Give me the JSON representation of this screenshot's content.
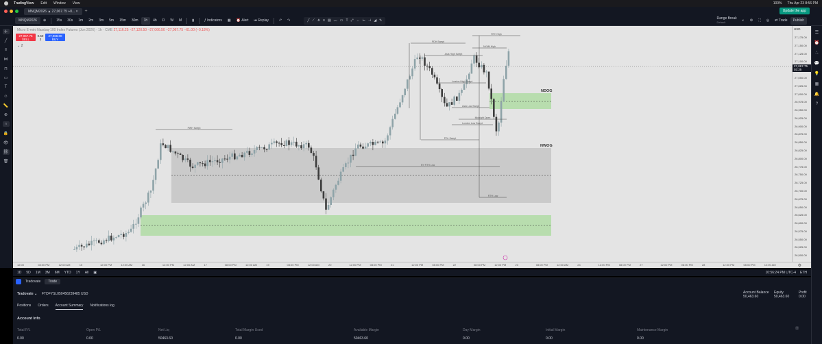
{
  "menubar": {
    "app": "TradingView",
    "items": [
      "Edit",
      "Window",
      "View"
    ],
    "clock": "Thu Apr 23  8:56 PM",
    "battery": "100%"
  },
  "tabbar": {
    "tab_title": "MNQM2026 ▲ 27,067.75 +0...",
    "update_label": "Update the app"
  },
  "toolbar": {
    "symbol": "MNQM2026",
    "intervals": [
      "15s",
      "30s",
      "1m",
      "2m",
      "3m",
      "5m",
      "15m",
      "30m",
      "1h",
      "4h",
      "D",
      "W",
      "M"
    ],
    "active_interval": "1h",
    "indicators_label": "Indicators",
    "alert_label": "Alert",
    "replay_label": "Replay",
    "range_break_label": "Range Break",
    "range_break_sub": "Default",
    "trade_label": "Trade",
    "publish_label": "Publish"
  },
  "legend": {
    "title": "Micro E-mini Nasdaq-100 Index Futures (Jun 2026) · 1h · CME",
    "values": "27,116.25  ~27,120.50  ~27,066.50  ~27,067.75  −61.00 (−0.18%)",
    "collapse": "⌄ 2"
  },
  "order_buttons": {
    "sell_price": "27,067.75",
    "sell_label": "SELL",
    "spread_top": "0.50",
    "spread_qty": "3",
    "buy_price": "27,068.00",
    "buy_label": "BUY"
  },
  "chart_labels": {
    "ndog": "NDOG",
    "nwog": "NWOG",
    "rth_high": "RTH High",
    "midnight": "Midnight Open",
    "london_low": "London Low Swept",
    "asia_high": "Asia High Swept",
    "pdh": "PDH Swept",
    "nyam_high": "NYAM High",
    "pdl": "PDL Swept",
    "rth_low": "RTH Low",
    "asia_low": "Asia Low Swept",
    "pwh": "PWH Swept",
    "london_high": "London High Swept",
    "nyrth_low": "NY RTH Low"
  },
  "price_axis": {
    "currency": "USD",
    "ticks": [
      "27,175.00",
      "27,150.00",
      "27,125.00",
      "27,100.00",
      "27,075.00",
      "27,050.00",
      "27,025.00",
      "27,000.00",
      "26,975.00",
      "26,950.00",
      "26,925.00",
      "26,900.00",
      "26,875.00",
      "26,850.00",
      "26,825.00",
      "26,800.00",
      "26,775.00",
      "26,750.00",
      "26,725.00",
      "26,700.00",
      "26,675.00",
      "26,650.00",
      "26,625.00",
      "26,600.00",
      "26,575.00",
      "26,550.00",
      "26,525.00",
      "26,500.00"
    ],
    "last_price": "27,067.75",
    "last_time": "03:35"
  },
  "time_axis": {
    "ticks": [
      "12:00",
      "08:00 PM",
      "12:00 AM",
      "15",
      "12:00 PM",
      "12:00 AM",
      "16",
      "12:00 PM",
      "12:00 AM",
      "17",
      "08:00 PM",
      "12:00 AM",
      "19",
      "08:00 PM",
      "12:00 AM",
      "20",
      "12:00 PM",
      "08:00 PM",
      "21",
      "12:00 PM",
      "08:00 PM",
      "22",
      "08:00 PM",
      "12:00 PM",
      "23",
      "08:00 PM",
      "12:00 AM",
      "24",
      "12:00 PM",
      "08:00 PM",
      "27",
      "12:00 PM",
      "08:00 PM",
      "28",
      "12:00 PM",
      "08:00 PM",
      "12:00 AM"
    ]
  },
  "periods": {
    "items": [
      "1D",
      "5D",
      "1M",
      "3M",
      "6M",
      "YTD",
      "1Y",
      "All"
    ],
    "clock": "10:56:24 PM UTC-4",
    "session": "ETH"
  },
  "panel": {
    "broker_tab": "Tradovate",
    "trade_tab": "Trade",
    "broker": "Tradovate ⌄",
    "account_id": "FTDFYSL050456239485 USD",
    "metrics": [
      {
        "label": "Account Balance",
        "value": "50,463.60"
      },
      {
        "label": "Equity",
        "value": "50,463.60"
      },
      {
        "label": "Profit",
        "value": "0.00"
      }
    ],
    "tabs": [
      "Positions",
      "Orders",
      "Account Summary",
      "Notifications log"
    ],
    "active_tab": "Account Summary",
    "info_title": "Account Info",
    "columns": [
      {
        "label": "Total P/L",
        "value": "0.00"
      },
      {
        "label": "Open P/L",
        "value": "0.00"
      },
      {
        "label": "Net Liq",
        "value": "50463.60"
      },
      {
        "label": "Total Margin Used",
        "value": "0.00"
      },
      {
        "label": "Available Margin",
        "value": "50463.60"
      },
      {
        "label": "Day Margin",
        "value": "0.00"
      },
      {
        "label": "Initial Margin",
        "value": "0.00"
      },
      {
        "label": "Maintenance Margin",
        "value": "0.00"
      }
    ]
  },
  "colors": {
    "up": "#8ea3a8",
    "down": "#3d3d3d",
    "zone_green": "#b3dba7",
    "zone_gray": "#c6c6c6",
    "accent": "#2962ff",
    "sell": "#f23645"
  }
}
